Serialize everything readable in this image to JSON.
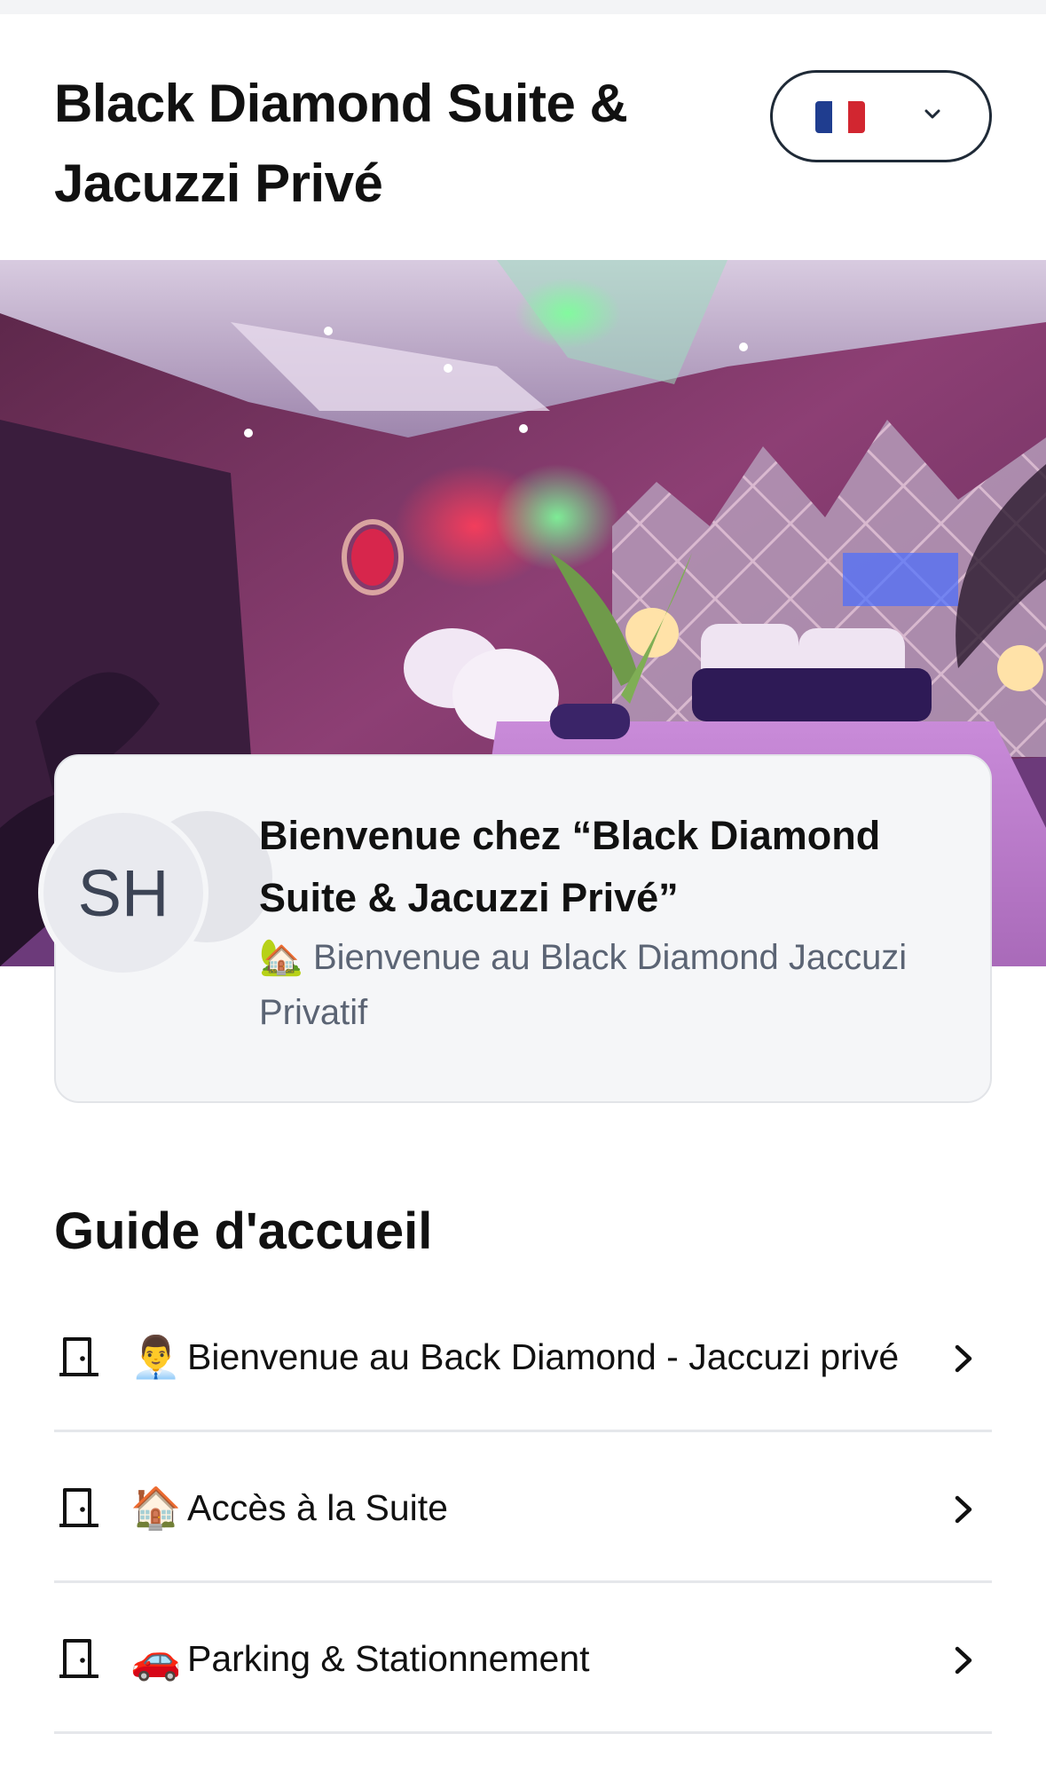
{
  "header": {
    "title": "Black Diamond Suite & Jacuzzi Privé",
    "language": {
      "selected_flag_icon": "flag-france-icon",
      "flag_colors": [
        "#1f3d8f",
        "#ffffff",
        "#d22630"
      ]
    }
  },
  "hero": {
    "image_icon": "hero-photo"
  },
  "welcome_card": {
    "avatar_initials": "SH",
    "title": "Bienvenue chez “Black Diamond Suite & Jacuzzi Privé”",
    "subtitle_emoji": "🏡",
    "subtitle": "Bienvenue au Black Diamond Jaccuzi Privatif"
  },
  "guide": {
    "heading": "Guide d'accueil",
    "items": [
      {
        "emoji": "👨‍💼",
        "label": "Bienvenue au Back Diamond - Jaccuzi privé"
      },
      {
        "emoji": "🏠",
        "label": "Accès à la Suite"
      },
      {
        "emoji": "🚗",
        "label": "Parking & Stationnement"
      }
    ]
  },
  "colors": {
    "text": "#111111",
    "muted": "#5b6474",
    "card_bg": "#f5f6f8",
    "divider": "#e5e7eb"
  }
}
